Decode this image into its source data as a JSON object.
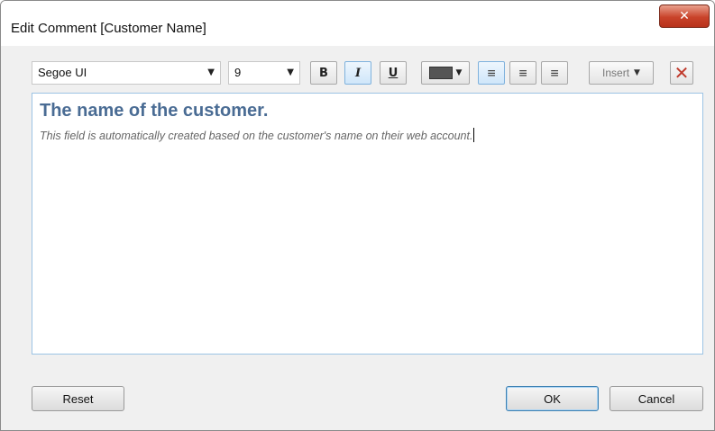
{
  "window": {
    "title": "Edit Comment [Customer Name]",
    "close_glyph": "✕"
  },
  "toolbar": {
    "font_family": "Segoe UI",
    "font_size": "9",
    "dropdown_glyph": "▼",
    "bold_label": "B",
    "italic_label": "I",
    "underline_label": "U",
    "text_color": "#555555",
    "align_left_glyph": "≡",
    "align_center_glyph": "≡",
    "align_right_glyph": "≡",
    "insert_label": "Insert",
    "delete_glyph": "✕"
  },
  "editor": {
    "heading": "The name of the customer.",
    "body": "This field is automatically created based on the customer's name on their web account."
  },
  "footer": {
    "reset_label": "Reset",
    "ok_label": "OK",
    "cancel_label": "Cancel"
  }
}
